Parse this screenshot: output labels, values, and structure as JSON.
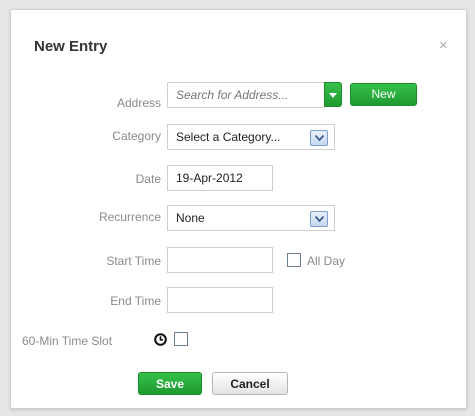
{
  "dialog": {
    "title": "New Entry",
    "close_glyph": "×"
  },
  "form": {
    "address": {
      "label": "Address",
      "placeholder": "Search for Address...",
      "new_button": "New"
    },
    "category": {
      "label": "Category",
      "selected": "Select a Category..."
    },
    "date": {
      "label": "Date",
      "value": "19-Apr-2012"
    },
    "recurrence": {
      "label": "Recurrence",
      "selected": "None"
    },
    "start_time": {
      "label": "Start Time",
      "value": "",
      "all_day_label": "All Day"
    },
    "end_time": {
      "label": "End Time",
      "value": ""
    },
    "time_slot": {
      "label": "60-Min Time Slot",
      "icon": "clock-icon"
    }
  },
  "actions": {
    "save": "Save",
    "cancel": "Cancel"
  },
  "colors": {
    "accent_green": "#2bb13f",
    "combo_blue": "#7b9fcf"
  }
}
